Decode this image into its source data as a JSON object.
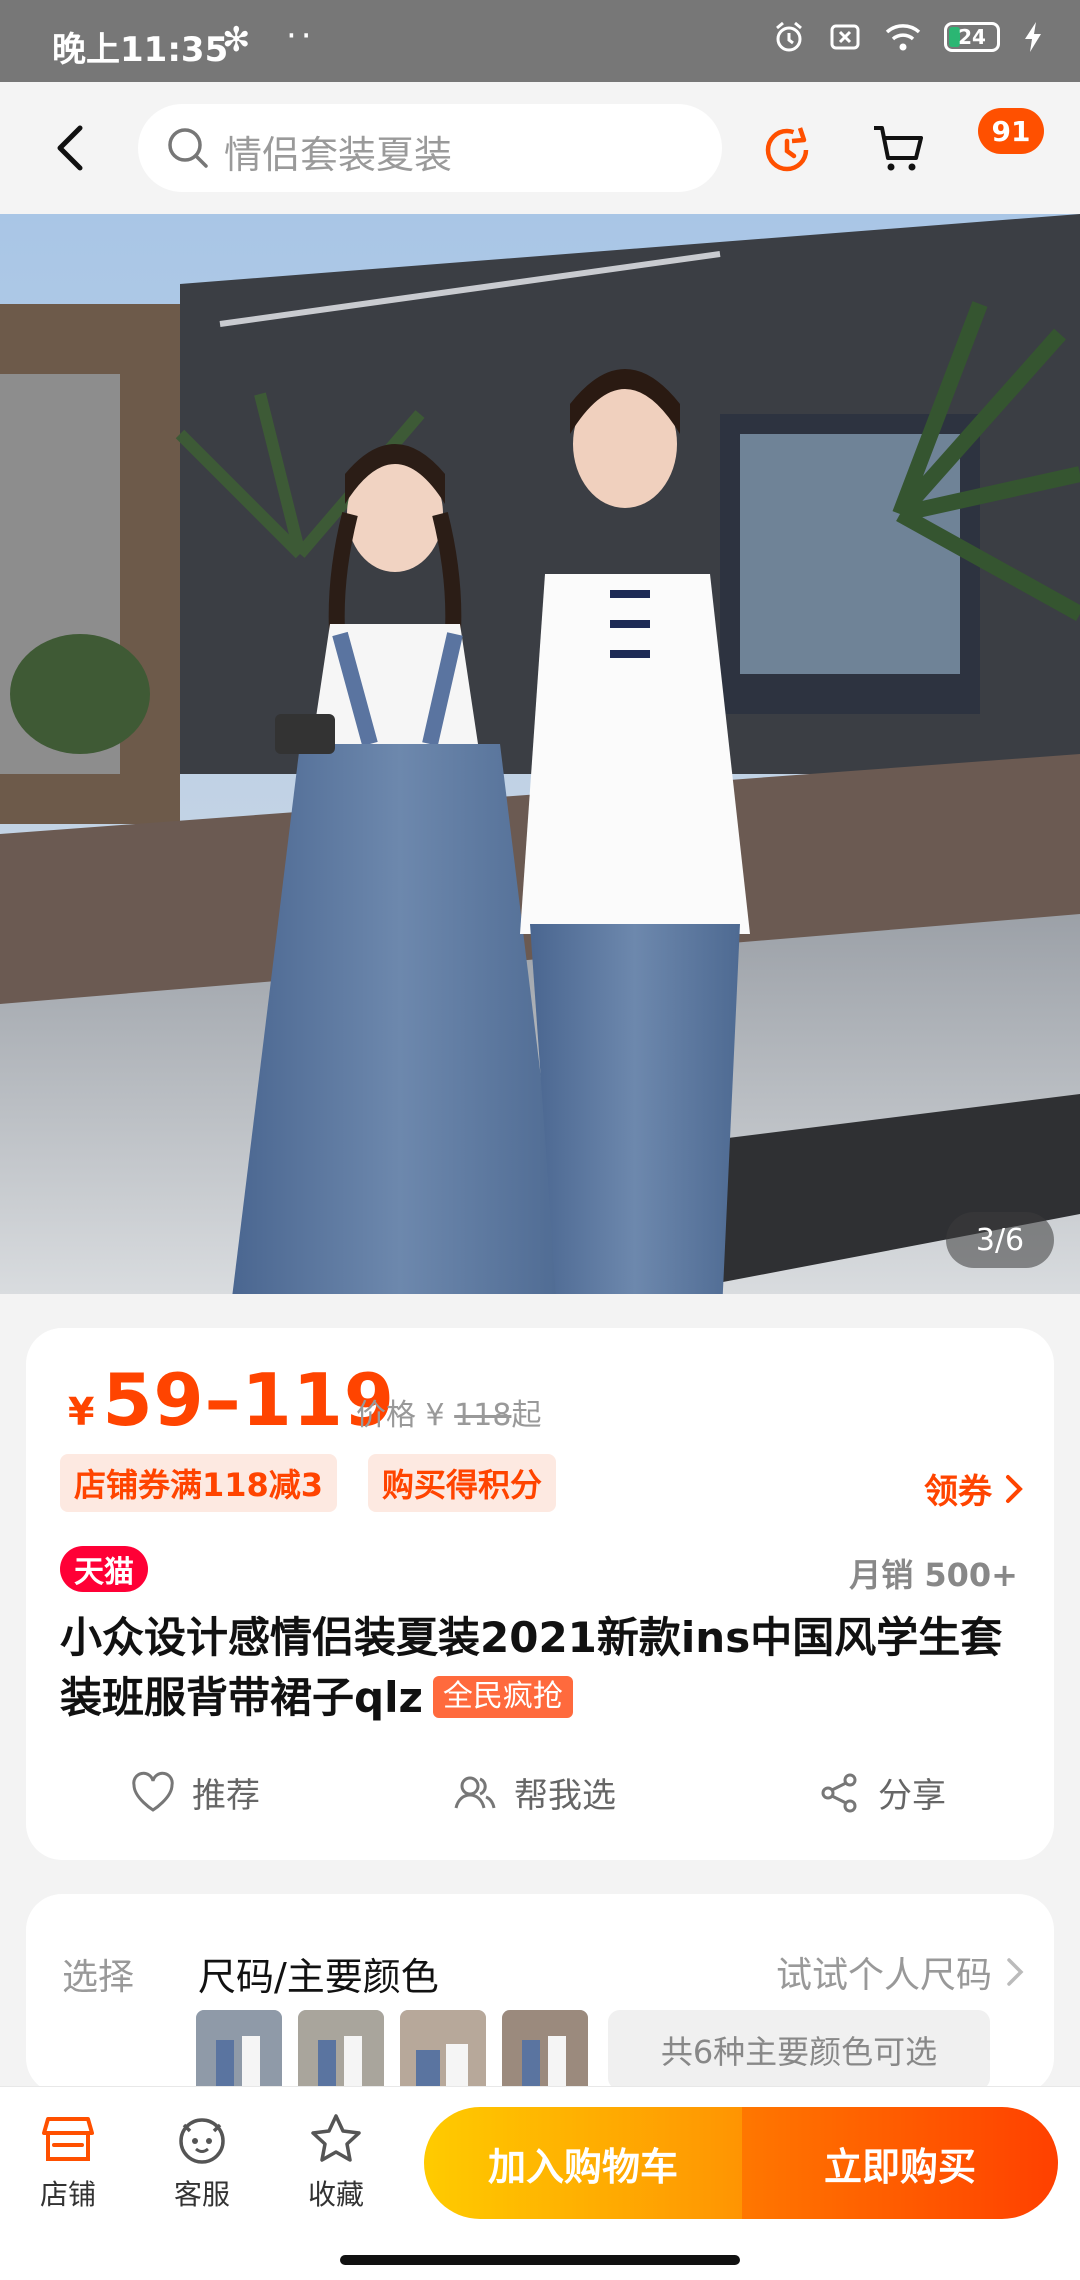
{
  "status_bar": {
    "time": "晚上11:35",
    "bluetooth": "✻",
    "dots": "··",
    "battery": "24"
  },
  "header": {
    "search_placeholder": "情侣套装夏装",
    "cart_badge": "91"
  },
  "gallery": {
    "pager": "3/6"
  },
  "price": {
    "currency": "¥",
    "range": "59–119",
    "original_label": "价格 ¥ ",
    "original_value": "118",
    "original_suffix": "起"
  },
  "promos": {
    "coupon_tag": "店铺券满118减3",
    "points_tag": "购买得积分",
    "claim_link": "领券"
  },
  "badge": {
    "tmall": "天猫",
    "monthly_sales": "月销 500+"
  },
  "product": {
    "title": "小众设计感情侣装夏装2021新款ins中国风学生套装班服背带裙子qlz",
    "hot_tag": "全民疯抢"
  },
  "actions": {
    "recommend": "推荐",
    "help_choose": "帮我选",
    "share": "分享"
  },
  "select": {
    "label": "选择",
    "value": "尺码/主要颜色",
    "try_size": "试试个人尺码",
    "more_colors": "共6种主要颜色可选"
  },
  "bottom_nav": {
    "store": "店铺",
    "service": "客服",
    "favorite": "收藏",
    "add_to_cart": "加入购物车",
    "buy_now": "立即购买"
  },
  "colors": {
    "accent": "#ff5000",
    "tmall_red": "#ff0036",
    "cart_yellow": "#ffcb00",
    "buy_orange": "#ff4000"
  }
}
